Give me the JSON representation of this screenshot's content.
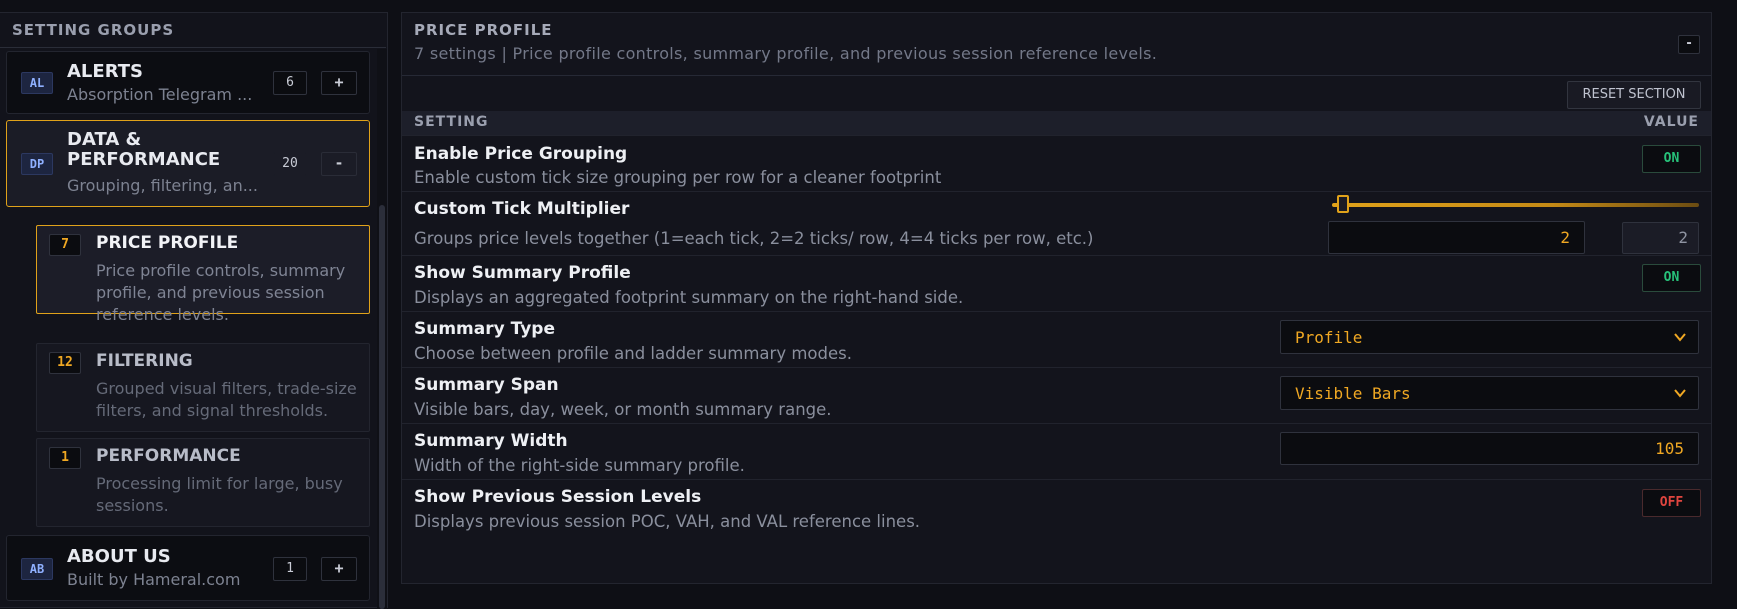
{
  "sidebar": {
    "header": "SETTING GROUPS",
    "groups": [
      {
        "code": "AL",
        "title": "ALERTS",
        "desc": "Absorption Telegram ...",
        "count": "6",
        "toggle": "+"
      },
      {
        "code": "DP",
        "title_line1": "DATA &",
        "title_line2": "PERFORMANCE",
        "desc": "Grouping, filtering, an...",
        "count": "20",
        "toggle": "-"
      },
      {
        "code": "AB",
        "title": "ABOUT US",
        "desc": "Built by Hameral.com",
        "count": "1",
        "toggle": "+"
      }
    ],
    "subgroups": [
      {
        "count": "7",
        "title": "PRICE PROFILE",
        "desc": "Price profile controls, summary profile, and previous session reference levels."
      },
      {
        "count": "12",
        "title": "FILTERING",
        "desc": "Grouped visual filters, trade-size filters, and signal thresholds."
      },
      {
        "count": "1",
        "title": "PERFORMANCE",
        "desc": "Processing limit for large, busy sessions."
      }
    ]
  },
  "section": {
    "title": "PRICE PROFILE",
    "subtitle": "7 settings | Price profile controls, summary profile, and previous session reference levels.",
    "collapse_label": "-",
    "reset_label": "RESET SECTION",
    "col_setting": "SETTING",
    "col_value": "VALUE"
  },
  "settings": [
    {
      "name": "Enable Price Grouping",
      "desc": "Enable custom tick size grouping per row for a cleaner footprint",
      "value": "ON"
    },
    {
      "name": "Custom Tick Multiplier",
      "desc": "Groups price levels together (1=each tick, 2=2 ticks/ row, 4=4 ticks per row, etc.)",
      "input": "2",
      "readout": "2",
      "slider_fraction": 0.02
    },
    {
      "name": "Show Summary Profile",
      "desc": "Displays an aggregated footprint summary on the right-hand side.",
      "value": "ON"
    },
    {
      "name": "Summary Type",
      "desc": "Choose between profile and ladder summary modes.",
      "value": "Profile"
    },
    {
      "name": "Summary Span",
      "desc": "Visible bars, day, week, or month summary range.",
      "value": "Visible Bars"
    },
    {
      "name": "Summary Width",
      "desc": "Width of the right-side summary profile.",
      "value": "105"
    },
    {
      "name": "Show Previous Session Levels",
      "desc": "Displays previous session POC, VAH, and VAL reference lines.",
      "value": "OFF"
    }
  ],
  "colors": {
    "accent": "#e0a21a",
    "on": "#27c27a",
    "off": "#e0453f",
    "value": "#f0a823"
  },
  "icons": {
    "dropdown": "chevron-down-icon"
  }
}
